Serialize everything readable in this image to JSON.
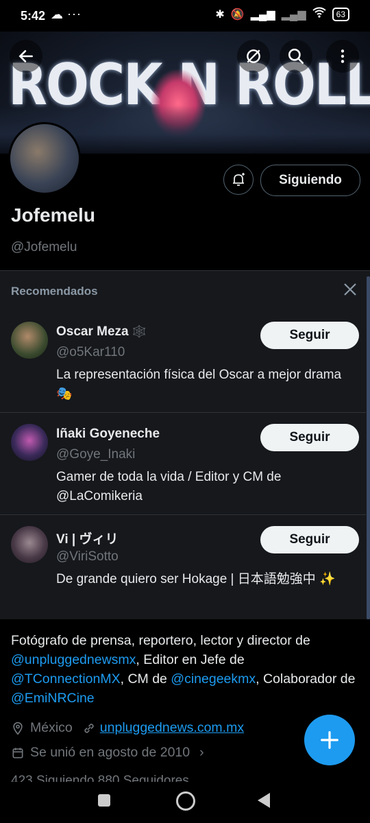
{
  "status_bar": {
    "time": "5:42",
    "battery": "63"
  },
  "banner": {
    "text": "ROCK N ROLL STAR"
  },
  "profile": {
    "name": "Jofemelu",
    "handle": "@Jofemelu",
    "following_label": "Siguiendo"
  },
  "recommended": {
    "title": "Recomendados",
    "follow_label": "Seguir",
    "items": [
      {
        "name": "Oscar Meza",
        "badge": "🕸️",
        "handle": "@o5Kar110",
        "bio": "La representación física del Oscar a mejor drama 🎭",
        "avatar_color": "#3a4a2e"
      },
      {
        "name": "Iñaki Goyeneche",
        "badge": "",
        "handle": "@Goye_Inaki",
        "bio": "Gamer de toda la vida / Editor y CM de @LaComikeria",
        "avatar_color": "#3a2a5a"
      },
      {
        "name": "Vi | ヴィリ",
        "badge": "",
        "handle": "@ViriSotto",
        "bio": "De grande quiero ser Hokage | 日本語勉強中 ✨",
        "avatar_color": "#4a3a48"
      }
    ]
  },
  "bio": {
    "p1": "Fotógrafo de prensa, reportero, lector y  director de ",
    "m1": "@unpluggednewsmx",
    "p2": ", Editor en Jefe de ",
    "m2": "@TConnectionMX",
    "p3": ", CM de ",
    "m3": "@cinegeekmx",
    "p4": ", Colaborador de ",
    "m4": "@EmiNRCine"
  },
  "meta": {
    "location": "México",
    "website": "unpluggednews.com.mx",
    "joined": "Se unió en agosto de 2010"
  },
  "counts": {
    "text": "423 Siguiendo   880 Seguidores"
  },
  "colors": {
    "accent": "#1d9bf0",
    "panel": "#16181c"
  }
}
